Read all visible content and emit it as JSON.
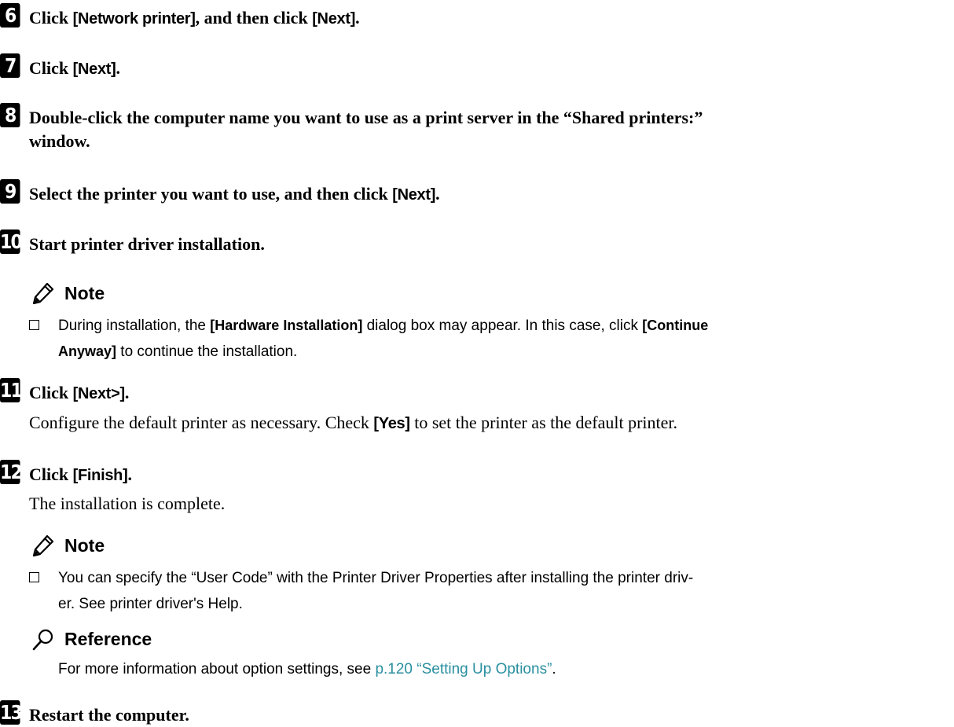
{
  "steps": [
    {
      "num": "6",
      "pre": "Click ",
      "btn": "[Network printer]",
      "mid": ", and then click ",
      "btn2": "[Next]",
      "post": "."
    },
    {
      "num": "7",
      "pre": "Click ",
      "btn": "[Next]",
      "post": "."
    },
    {
      "num": "8",
      "line1": "Double-click the computer name you want to use as a print server in the “Shared printers:”",
      "line2": "window."
    },
    {
      "num": "9",
      "pre": "Select the printer you want to use, and then click ",
      "btn": "[Next]",
      "post": "."
    },
    {
      "num": "10",
      "text": "Start printer driver installation."
    },
    {
      "num": "11",
      "pre": "Click ",
      "btn": "[Next>]",
      "post": "."
    },
    {
      "num": "12",
      "pre": "Click ",
      "btn": "[Finish]",
      "post": "."
    },
    {
      "num": "13",
      "text": "Restart the computer."
    }
  ],
  "note1": {
    "heading": "Note",
    "pre": "During installation, the ",
    "btn": "[Hardware Installation]",
    "mid": " dialog box may appear. In this case, click ",
    "btn2": "[Continue",
    "btn2b": "Anyway]",
    "post": " to continue the installation."
  },
  "step11_body": {
    "pre": "Configure the default printer as necessary. Check ",
    "btn": "[Yes]",
    "post": " to set the printer as the default printer."
  },
  "step12_body": "The installation is complete.",
  "note2": {
    "heading": "Note",
    "line1": "You can specify the “User Code” with the Printer Driver Properties after installing the printer driv-",
    "line2": "er. See printer driver's Help."
  },
  "reference": {
    "heading": "Reference",
    "pre": "For more information about option settings, see ",
    "link": "p.120 “Setting Up Options”",
    "post": "."
  },
  "icons": {
    "note": "pencil-icon",
    "reference": "magnifier-icon",
    "checkbox": "checkbox-icon"
  },
  "colors": {
    "link": "#2a8fa0"
  }
}
